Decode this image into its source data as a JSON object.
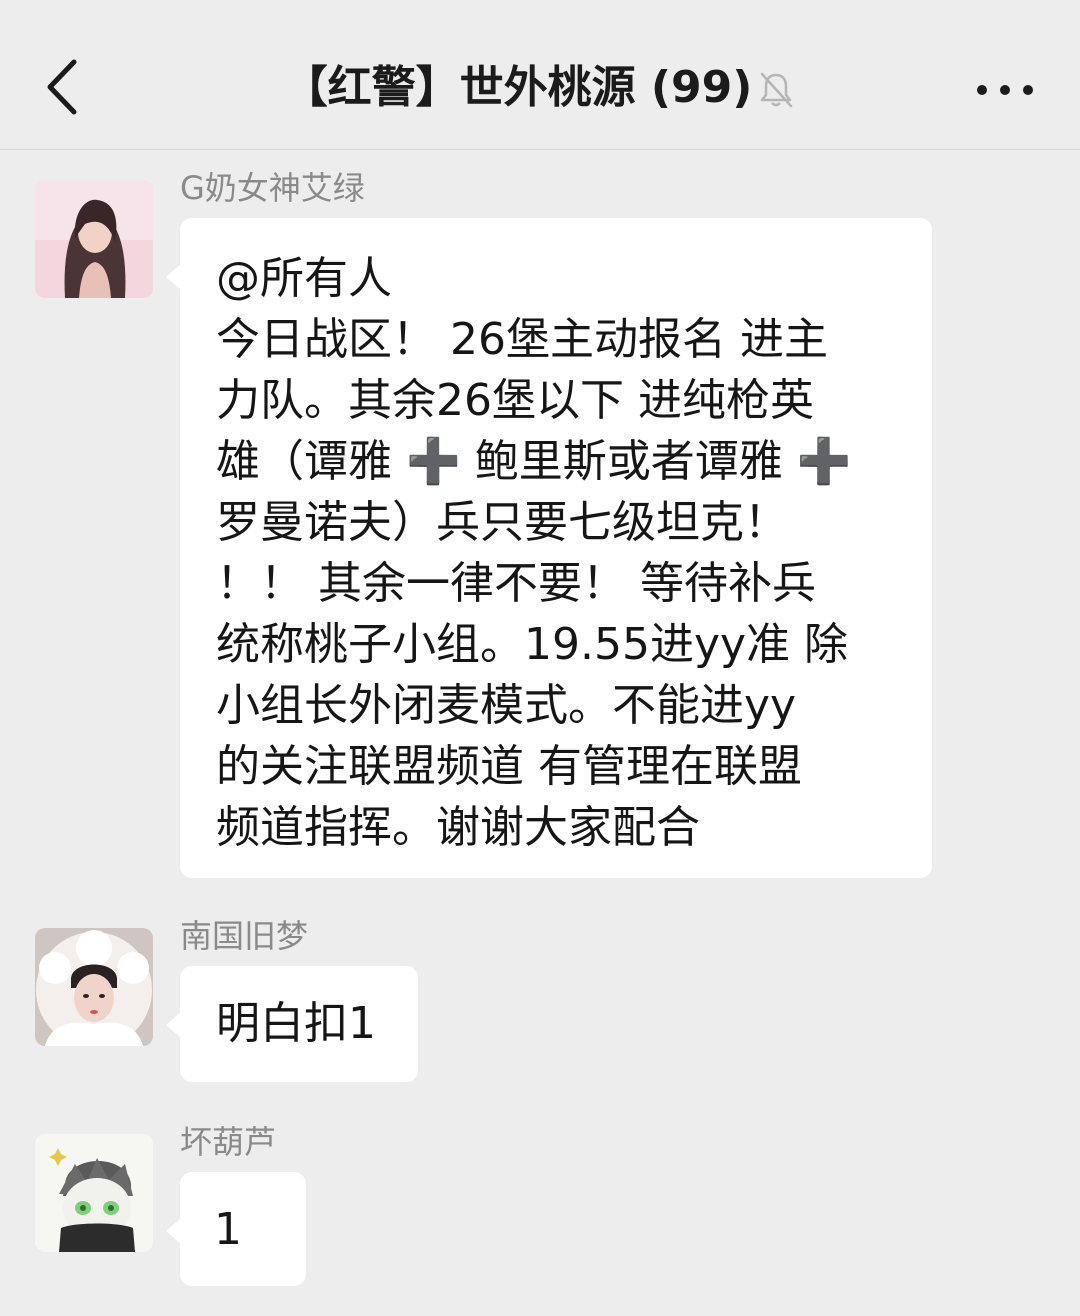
{
  "header": {
    "title": "【红警】世外桃源 (99)",
    "back_icon": "chevron-left-icon",
    "mute_icon": "bell-off-icon",
    "more_icon": "more-dots-icon"
  },
  "messages": [
    {
      "sender": "G奶女神艾绿",
      "lines": [
        "@所有人",
        "今日战区！ 26堡主动报名 进主",
        "力队。其余26堡以下 进纯枪英",
        "雄（谭雅 ➕ 鲍里斯或者谭雅 ➕",
        "罗曼诺夫）兵只要七级坦克！",
        "！！ 其余一律不要！ 等待补兵",
        "统称桃子小组。19.55进yy准 除",
        "小组长外闭麦模式。不能进yy",
        "的关注联盟频道 有管理在联盟",
        "频道指挥。谢谢大家配合"
      ]
    },
    {
      "sender": "南国旧梦",
      "lines": [
        "明白扣1"
      ]
    },
    {
      "sender": "坏葫芦",
      "lines": [
        "1"
      ]
    }
  ],
  "colors": {
    "background": "#ededed",
    "bubble": "#ffffff",
    "sender_text": "#8a8a8a"
  }
}
